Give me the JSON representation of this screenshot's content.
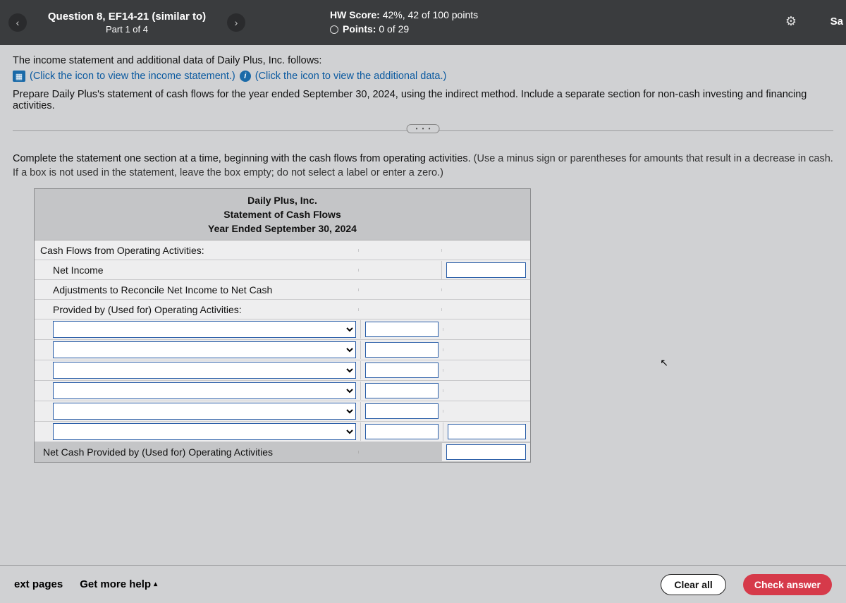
{
  "header": {
    "prev_glyph": "‹",
    "next_glyph": "›",
    "question_title": "Question 8, EF14-21 (similar to)",
    "part": "Part 1 of 4",
    "hw_score_label": "HW Score:",
    "hw_score_value": "42%, 42 of 100 points",
    "points_label": "Points:",
    "points_value": "0 of 29",
    "gear_glyph": "⚙",
    "save_frag": "Sa"
  },
  "problem": {
    "intro": "The income statement and additional data of Daily Plus, Inc. follows:",
    "link1": "(Click the icon to view the income statement.)",
    "link2": "(Click the icon to view the additional data.)",
    "task": "Prepare Daily Plus's statement of cash flows for the year ended September 30, 2024, using the indirect method. Include a separate section for non-cash investing and financing activities.",
    "dots": "• • •"
  },
  "instruction": {
    "main": "Complete the statement one section at a time, beginning with the cash flows from operating activities. ",
    "hint": "(Use a minus sign or parentheses for amounts that result in a decrease in cash. If a box is not used in the statement, leave the box empty; do not select a label or enter a zero.)"
  },
  "worksheet": {
    "company": "Daily Plus, Inc.",
    "title": "Statement of Cash Flows",
    "period": "Year Ended September 30, 2024",
    "rows": {
      "op_header": "Cash Flows from Operating Activities:",
      "net_income": "Net Income",
      "adj1": "Adjustments to Reconcile Net Income to Net Cash",
      "adj2": "Provided by (Used for) Operating Activities:",
      "net_op": "Net Cash Provided by (Used for) Operating Activities"
    }
  },
  "bottom": {
    "ext_pages": "ext pages",
    "help": "Get more help",
    "caret": "▴",
    "clear": "Clear all",
    "check": "Check answer"
  },
  "icons": {
    "grid": "▦",
    "info": "i",
    "cursor": "➤"
  }
}
